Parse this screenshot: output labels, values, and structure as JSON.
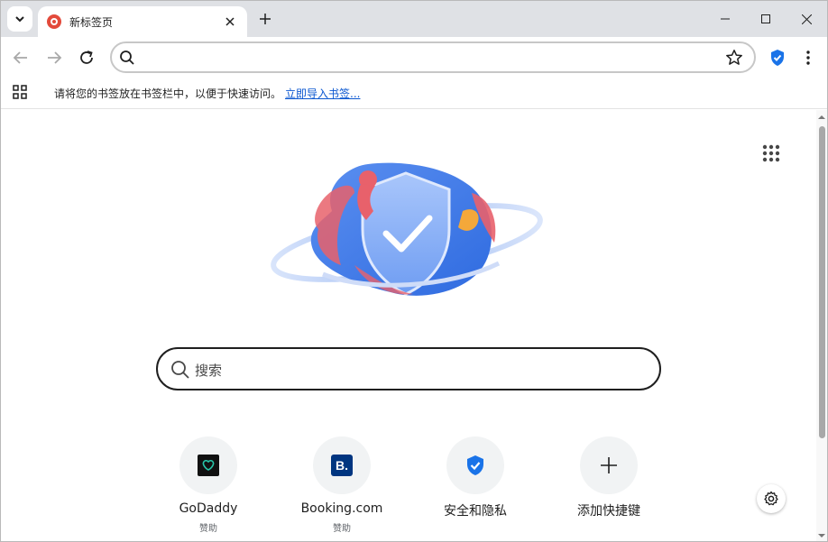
{
  "tab": {
    "title": "新标签页"
  },
  "omnibox": {
    "value": ""
  },
  "bookmarks_bar": {
    "hint": "请将您的书签放在书签栏中，以便于快速访问。",
    "import_link": "立即导入书签..."
  },
  "search": {
    "placeholder": "搜索"
  },
  "shortcuts": [
    {
      "title": "GoDaddy",
      "subtitle": "赞助",
      "icon": "godaddy-logo"
    },
    {
      "title": "Booking.com",
      "subtitle": "赞助",
      "icon": "booking-logo"
    },
    {
      "title": "安全和隐私",
      "subtitle": "",
      "icon": "shield-check-icon"
    },
    {
      "title": "添加快捷键",
      "subtitle": "",
      "icon": "plus-icon"
    }
  ],
  "colors": {
    "accent": "#0b57d0",
    "shield_blue": "#1a73e8",
    "tab_strip": "#dfe1e5"
  }
}
